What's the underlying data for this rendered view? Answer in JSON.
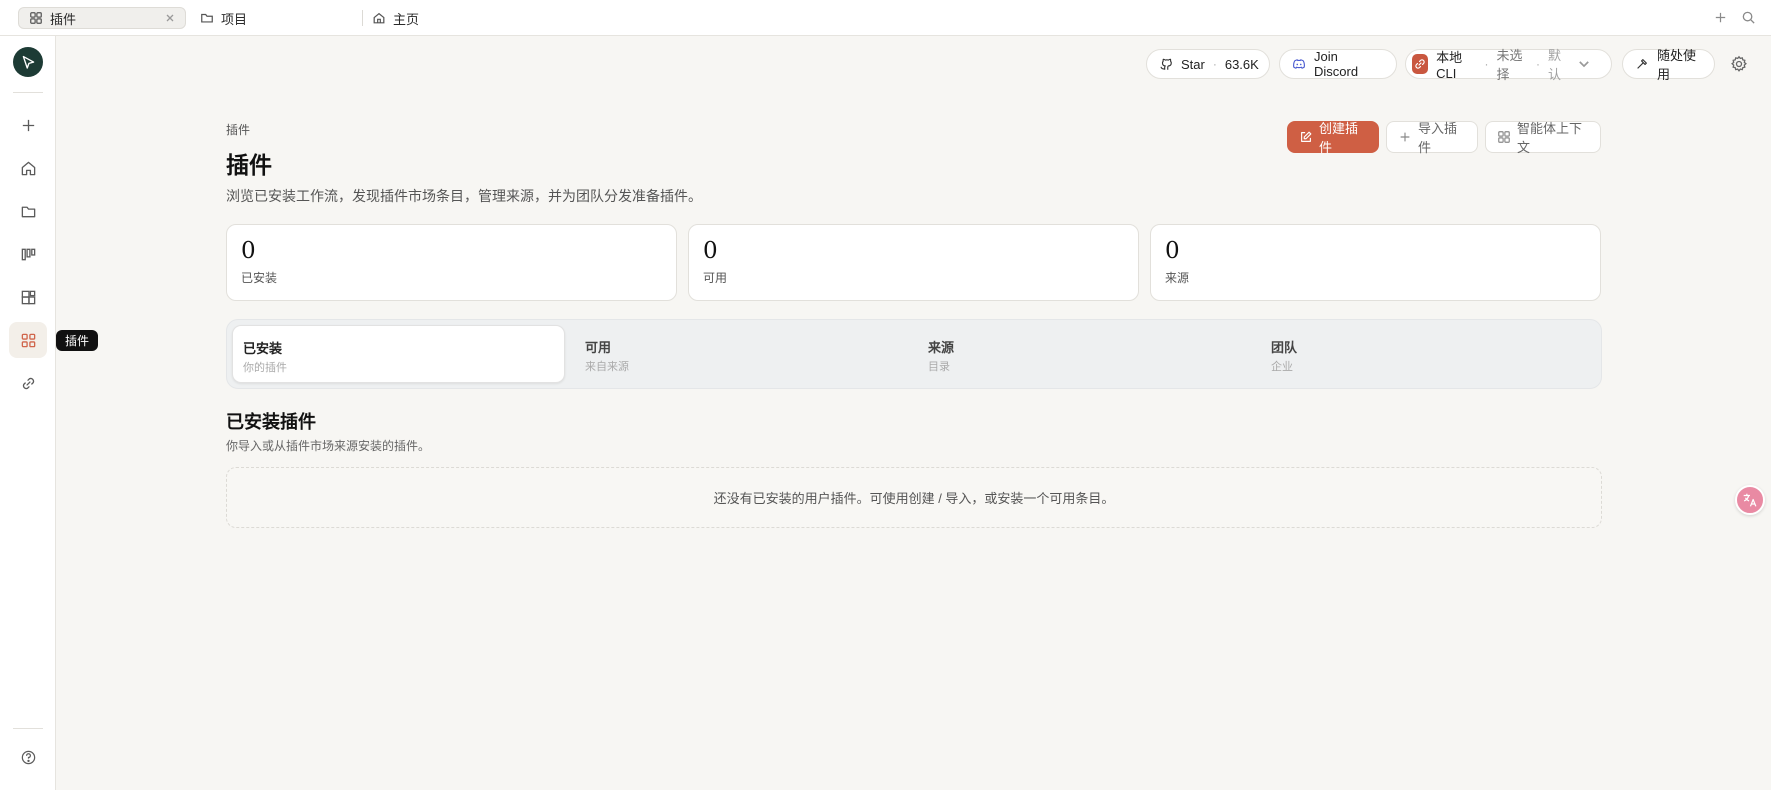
{
  "tabs": [
    {
      "label": "插件",
      "icon": "grid-icon",
      "active": true
    },
    {
      "label": "项目",
      "icon": "folder-icon",
      "active": false
    },
    {
      "label": "主页",
      "icon": "home-icon",
      "active": false
    }
  ],
  "rail": {
    "tooltip": "插件",
    "items": [
      "add-icon",
      "home-icon",
      "folder-icon",
      "kanban-icon",
      "apps-icon",
      "grid-icon",
      "link-icon"
    ],
    "active": "grid-icon"
  },
  "toolbar": {
    "star_label": "Star",
    "star_count": "63.6K",
    "discord_label": "Join Discord",
    "cli_label": "本地 CLI",
    "cli_model": "未选择",
    "cli_default": "默认",
    "use_label": "随处使用"
  },
  "page": {
    "breadcrumb": "插件",
    "title": "插件",
    "description": "浏览已安装工作流，发现插件市场条目，管理来源，并为团队分发准备插件。",
    "buttons": {
      "create": "创建插件",
      "import": "导入插件",
      "context": "智能体上下文"
    }
  },
  "stats": [
    {
      "value": "0",
      "label": "已安装"
    },
    {
      "value": "0",
      "label": "可用"
    },
    {
      "value": "0",
      "label": "来源"
    }
  ],
  "segments": [
    {
      "title": "已安装",
      "subtitle": "你的插件",
      "active": true
    },
    {
      "title": "可用",
      "subtitle": "来自来源",
      "active": false
    },
    {
      "title": "来源",
      "subtitle": "目录",
      "active": false
    },
    {
      "title": "团队",
      "subtitle": "企业",
      "active": false
    }
  ],
  "installed": {
    "title": "已安装插件",
    "description": "你导入或从插件市场来源安装的插件。",
    "empty_text": "还没有已安装的用户插件。可使用创建 / 导入，或安装一个可用条目。"
  },
  "colors": {
    "accent": "#cf5f44",
    "logo_bg": "#1d3b35",
    "translate_badge": "#e98aa3"
  }
}
